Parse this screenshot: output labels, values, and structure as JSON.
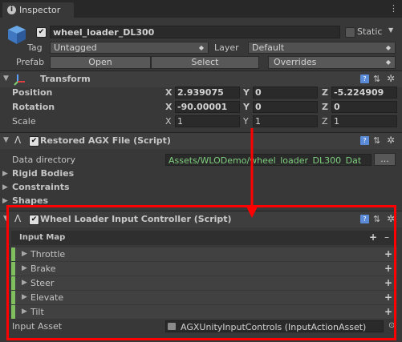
{
  "tab": {
    "label": "Inspector",
    "icon": "info-icon",
    "menu": "menu-icon"
  },
  "object": {
    "name": "wheel_loader_DL300",
    "active": true,
    "static_label": "Static",
    "static": false,
    "tag_label": "Tag",
    "tag_value": "Untagged",
    "layer_label": "Layer",
    "layer_value": "Default",
    "prefab_label": "Prefab",
    "open_label": "Open",
    "select_label": "Select",
    "overrides_label": "Overrides"
  },
  "transform": {
    "title": "Transform",
    "position_label": "Position",
    "rotation_label": "Rotation",
    "scale_label": "Scale",
    "position": {
      "x": "2.939075",
      "y": "0",
      "z": "-5.224909"
    },
    "rotation": {
      "x": "-90.00001",
      "y": "0",
      "z": "0"
    },
    "scale": {
      "x": "1",
      "y": "1",
      "z": "1"
    },
    "axis_x": "X",
    "axis_y": "Y",
    "axis_z": "Z"
  },
  "agx_file": {
    "title": "Restored AGX File (Script)",
    "dir_label": "Data directory",
    "dir_value": "Assets/WLODemo/wheel_loader_DL300_Dat",
    "browse_label": "...",
    "sections": [
      "Rigid Bodies",
      "Constraints",
      "Shapes"
    ]
  },
  "input_controller": {
    "title": "Wheel Loader Input Controller (Script)",
    "input_map_label": "Input Map",
    "add": "+",
    "remove": "–",
    "actions": [
      "Throttle",
      "Brake",
      "Steer",
      "Elevate",
      "Tilt"
    ],
    "input_asset_label": "Input Asset",
    "input_asset_value": "AGXUnityInputControls (InputActionAsset)"
  },
  "colors": {
    "accent_green": "#7fbf5f",
    "annotation_red": "#ff0000"
  }
}
